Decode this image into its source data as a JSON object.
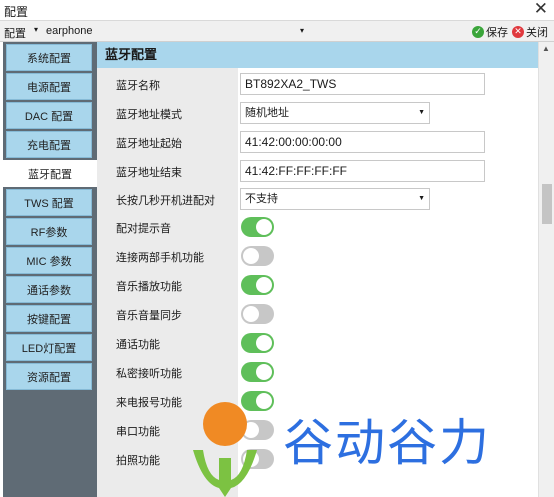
{
  "window": {
    "title": "配置",
    "close_glyph": "✕"
  },
  "toolbar": {
    "config_label": "配置",
    "dropdown_arrow": "▾",
    "selected_profile": "earphone",
    "save_label": "保存",
    "close_label": "关闭",
    "save_icon": "✓",
    "close_icon": "✕"
  },
  "sidebar": {
    "items": [
      {
        "label": "系统配置",
        "active": false
      },
      {
        "label": "电源配置",
        "active": false
      },
      {
        "label": "DAC 配置",
        "active": false
      },
      {
        "label": "充电配置",
        "active": false
      },
      {
        "label": "蓝牙配置",
        "active": true
      },
      {
        "label": "TWS 配置",
        "active": false
      },
      {
        "label": "RF参数",
        "active": false
      },
      {
        "label": "MIC 参数",
        "active": false
      },
      {
        "label": "通话参数",
        "active": false
      },
      {
        "label": "按键配置",
        "active": false
      },
      {
        "label": "LED灯配置",
        "active": false
      },
      {
        "label": "资源配置",
        "active": false
      }
    ]
  },
  "panel": {
    "title": "蓝牙配置",
    "fields": {
      "bt_name": {
        "label": "蓝牙名称",
        "value": "BT892XA2_TWS"
      },
      "addr_mode": {
        "label": "蓝牙地址模式",
        "value": "随机地址"
      },
      "addr_start": {
        "label": "蓝牙地址起始",
        "value": "41:42:00:00:00:00"
      },
      "addr_end": {
        "label": "蓝牙地址结束",
        "value": "41:42:FF:FF:FF:FF"
      },
      "long_press_pair": {
        "label": "长按几秒开机进配对",
        "value": "不支持"
      }
    },
    "toggles": [
      {
        "label": "配对提示音",
        "on": true
      },
      {
        "label": "连接两部手机功能",
        "on": false
      },
      {
        "label": "音乐播放功能",
        "on": true
      },
      {
        "label": "音乐音量同步",
        "on": false
      },
      {
        "label": "通话功能",
        "on": true
      },
      {
        "label": "私密接听功能",
        "on": true
      },
      {
        "label": "来电报号功能",
        "on": true
      },
      {
        "label": "串口功能",
        "on": false
      },
      {
        "label": "拍照功能",
        "on": false
      }
    ]
  },
  "watermark": {
    "text": "谷动谷力"
  },
  "colors": {
    "accent": "#a9d6ec",
    "sidebar_bg": "#5f6b75",
    "toggle_on": "#5fbf5a",
    "toggle_off": "#c7c7c7",
    "watermark": "#2d6fe0",
    "logo_orange": "#f08a24",
    "logo_green": "#7cc242"
  }
}
